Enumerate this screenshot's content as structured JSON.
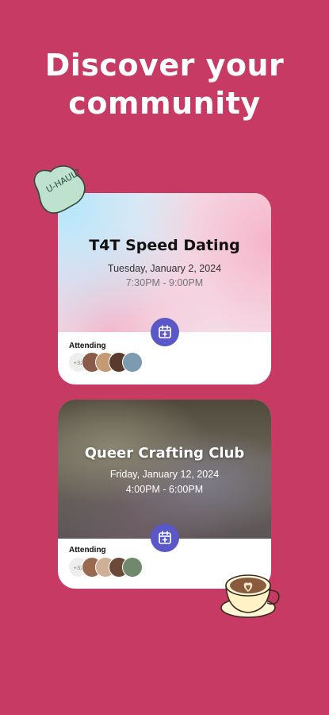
{
  "headline": "Discover your community",
  "sticker_heart": {
    "text": "U-HAUL?",
    "icon": "heart-candy-icon"
  },
  "sticker_coffee": {
    "icon": "coffee-latte-icon"
  },
  "events": [
    {
      "title": "T4T Speed Dating",
      "date": "Tuesday, January 2, 2024",
      "time": "7:30PM - 9:00PM",
      "attending_label": "Attending",
      "attending_more": "+32"
    },
    {
      "title": "Queer Crafting Club",
      "date": "Friday, January 12, 2024",
      "time": "4:00PM - 6:00PM",
      "attending_label": "Attending",
      "attending_more": "+32"
    }
  ],
  "colors": {
    "background": "#c63a63",
    "calendar_button": "#5a57c6",
    "card": "#ffffff"
  }
}
